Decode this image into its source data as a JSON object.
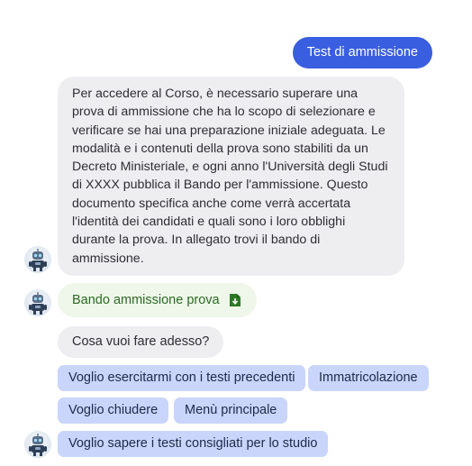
{
  "chat": {
    "user_message": "Test di ammissione",
    "bot_message": "Per accedere al Corso, è necessario superare una prova di ammissione che ha lo scopo di selezionare e verificare se hai una preparazione iniziale adeguata. Le modalità e i contenuti della prova sono stabiliti da un Decreto Ministeriale, e ogni anno l'Università degli Studi di XXXX pubblica il Bando per l'ammissione. Questo documento specifica anche come verrà accertata l'identità dei candidati e quali sono i loro obblighi durante la prova. In allegato trovi il bando di ammissione.",
    "attachment": {
      "label": "Bando ammissione prova",
      "icon": "file-download-icon",
      "color": "#2d6a23"
    },
    "question": "Cosa vuoi fare adesso?",
    "options": [
      "Voglio esercitarmi con i testi precedenti",
      "Immatricolazione",
      "Voglio chiudere",
      "Menù principale",
      "Voglio sapere i testi consigliati per lo studio"
    ]
  },
  "avatar": {
    "icon": "robot-icon"
  },
  "colors": {
    "user_bubble": "#3a5ee0",
    "bot_bubble": "#eeeef1",
    "chip": "#c9d5fb",
    "attachment_bubble": "#eef7ea"
  }
}
